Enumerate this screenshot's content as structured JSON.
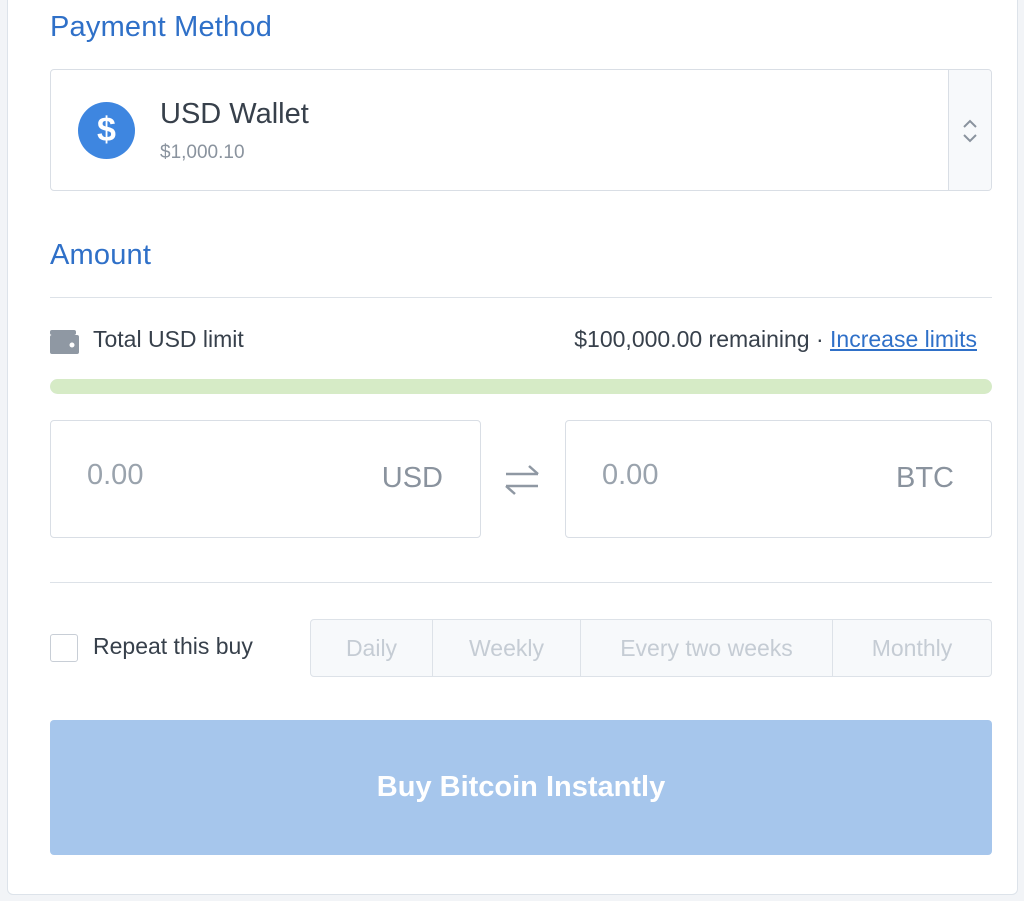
{
  "payment_method": {
    "title": "Payment Method",
    "wallet": {
      "icon": "dollar-icon",
      "symbol": "$",
      "name": "USD Wallet",
      "balance": "$1,000.10"
    },
    "toggle_icon": "chevron-up-down-icon"
  },
  "amount": {
    "title": "Amount",
    "limit": {
      "icon": "wallet-icon",
      "label": "Total USD limit",
      "remaining": "$100,000.00 remaining",
      "separator": " · ",
      "link_label": "Increase limits",
      "progress": 1.0
    },
    "usd": {
      "placeholder": "0.00",
      "unit": "USD"
    },
    "btc": {
      "placeholder": "0.00",
      "unit": "BTC"
    },
    "swap_icon": "swap-arrows-icon"
  },
  "repeat": {
    "label": "Repeat this buy",
    "checked": false,
    "options": [
      "Daily",
      "Weekly",
      "Every two weeks",
      "Monthly"
    ]
  },
  "buy_button": {
    "label": "Buy Bitcoin Instantly"
  },
  "colors": {
    "accent": "#2f70c8",
    "wallet_icon_bg": "#3e86e0",
    "limit_fill": "#d6ebc6",
    "button_disabled": "#a6c6ec"
  }
}
